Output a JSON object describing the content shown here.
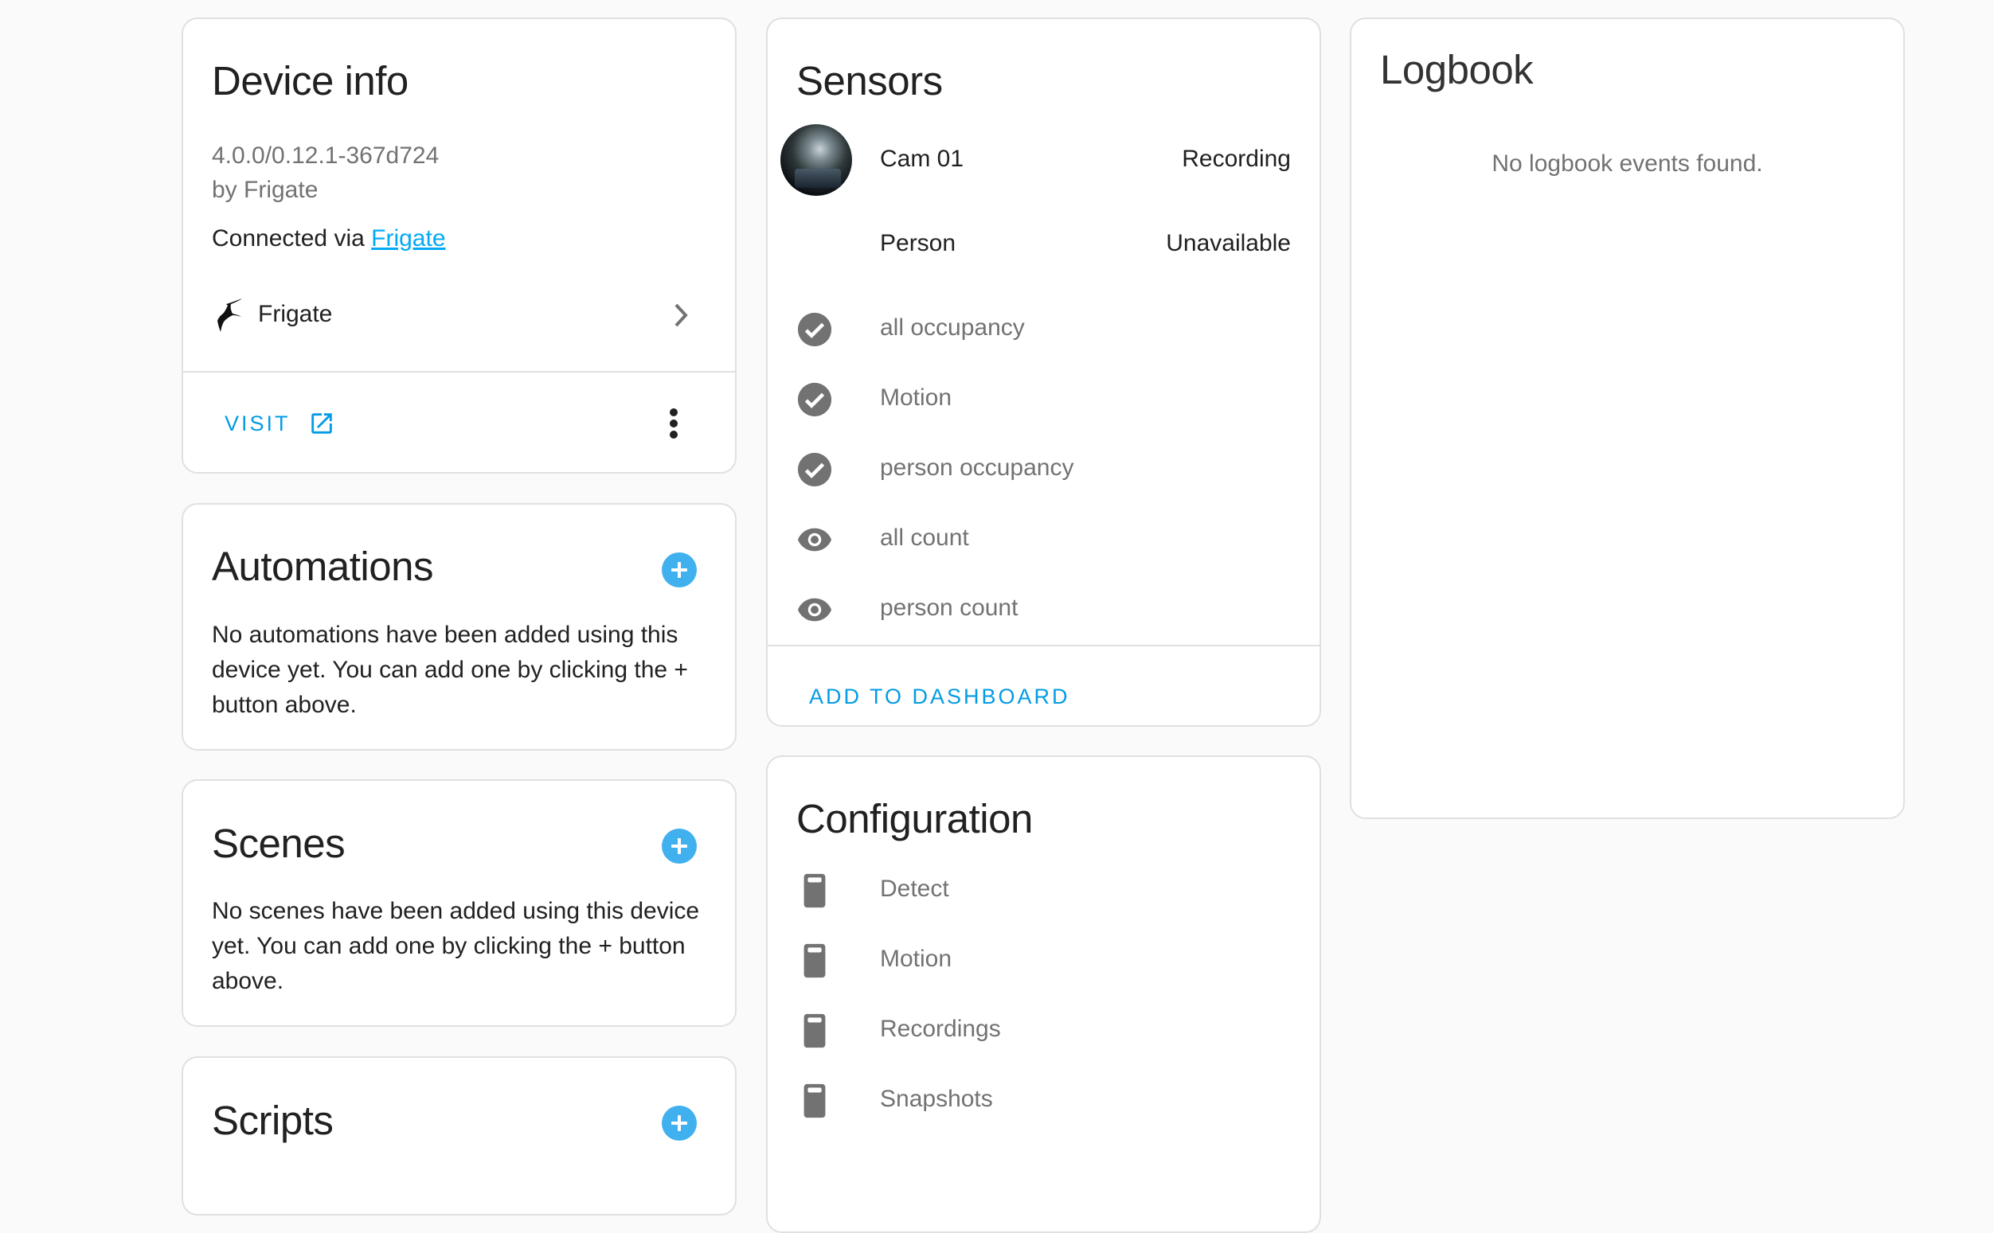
{
  "device_info": {
    "title": "Device info",
    "version": "4.0.0/0.12.1-367d724",
    "manufacturer": "by Frigate",
    "connected_via_prefix": "Connected via ",
    "connected_via_link": "Frigate",
    "integration": {
      "name": "Frigate",
      "icon": "frigate-bird-logo"
    },
    "visit_label": "VISIT",
    "visit_icon": "open-in-new-icon",
    "more_icon": "dots-vertical-icon"
  },
  "automations": {
    "title": "Automations",
    "description": "No automations have been added using this device yet. You can add one by clicking the + button above."
  },
  "scenes": {
    "title": "Scenes",
    "description": "No scenes have been added using this device yet. You can add one by clicking the + button above."
  },
  "scripts": {
    "title": "Scripts"
  },
  "sensors": {
    "title": "Sensors",
    "entities": [
      {
        "name": "Cam 01",
        "state": "Recording",
        "icon": "camera-thumbnail"
      },
      {
        "name": "Person",
        "state": "Unavailable",
        "icon": "none"
      }
    ],
    "secondary": [
      {
        "name": "all occupancy",
        "icon": "check-circle-icon"
      },
      {
        "name": "Motion",
        "icon": "check-circle-icon"
      },
      {
        "name": "person occupancy",
        "icon": "check-circle-icon"
      },
      {
        "name": "all count",
        "icon": "eye-icon"
      },
      {
        "name": "person count",
        "icon": "eye-icon"
      }
    ],
    "add_to_dashboard_label": "ADD TO DASHBOARD"
  },
  "configuration": {
    "title": "Configuration",
    "items": [
      {
        "name": "Detect",
        "icon": "toggle-switch-off-icon"
      },
      {
        "name": "Motion",
        "icon": "toggle-switch-off-icon"
      },
      {
        "name": "Recordings",
        "icon": "toggle-switch-off-icon"
      },
      {
        "name": "Snapshots",
        "icon": "toggle-switch-off-icon"
      }
    ]
  },
  "logbook": {
    "title": "Logbook",
    "empty_message": "No logbook events found."
  },
  "colors": {
    "accent": "#03a9f4",
    "plus_button": "#41b0ef",
    "icon_gray": "#727272",
    "card_border": "#e0e0e0",
    "background": "#fafafa"
  }
}
